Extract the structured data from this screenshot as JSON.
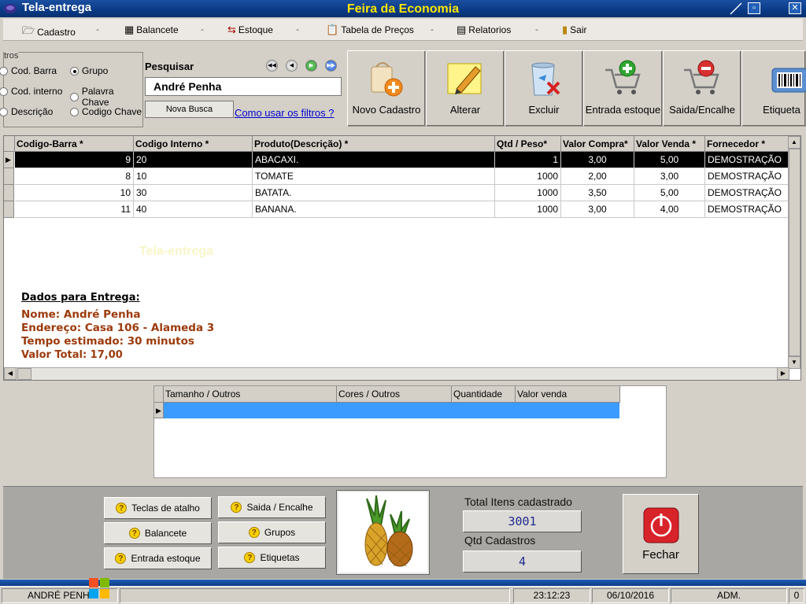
{
  "window": {
    "title": "Tela-entrega",
    "app_name": "Feira da Economia",
    "btn_restore": "▫",
    "btn_close": "✕"
  },
  "menu": {
    "items": [
      {
        "label": "Cadastro",
        "icon": "folder-icon"
      },
      {
        "label": "Balancete",
        "icon": "calculator-icon"
      },
      {
        "label": "Estoque",
        "icon": "stock-icon"
      },
      {
        "label": "Tabela de Preços",
        "icon": "clipboard-icon"
      },
      {
        "label": "Relatorios",
        "icon": "reports-icon"
      },
      {
        "label": "Sair",
        "icon": "exit-icon"
      }
    ],
    "separator": "-"
  },
  "filters": {
    "legend": "tros",
    "options": [
      {
        "label": "Cod. Barra",
        "selected": false
      },
      {
        "label": "Grupo",
        "selected": true
      },
      {
        "label": "Cod. interno",
        "selected": false
      },
      {
        "label": "Palavra Chave",
        "selected": false
      },
      {
        "label": "Descrição",
        "selected": false
      },
      {
        "label": "Codigo Chave",
        "selected": false
      }
    ]
  },
  "search": {
    "label": "Pesquisar",
    "value": "André Penha",
    "new_search": "Nova Busca",
    "help_link": "Como usar os filtros ?"
  },
  "toolbar": {
    "buttons": [
      {
        "label": "Novo Cadastro",
        "icon": "new-record-icon"
      },
      {
        "label": "Alterar",
        "icon": "edit-icon"
      },
      {
        "label": "Excluir",
        "icon": "recycle-bin-icon"
      },
      {
        "label": "Entrada estoque",
        "icon": "cart-add-icon"
      },
      {
        "label": "Saida/Encalhe",
        "icon": "cart-remove-icon"
      },
      {
        "label": "Etiqueta",
        "icon": "barcode-icon"
      }
    ]
  },
  "grid": {
    "columns": [
      "Codigo-Barra  *",
      "Codigo Interno *",
      "Produto(Descrição)    *",
      "Qtd / Peso*",
      "Valor Compra*",
      "Valor Venda *",
      "Fornecedor    *"
    ],
    "rows": [
      [
        "9",
        "20",
        "ABACAXI.",
        "1",
        "3,00",
        "5,00",
        "DEMOSTRAÇÃO"
      ],
      [
        "8",
        "10",
        "TOMATE",
        "1000",
        "2,00",
        "3,00",
        "DEMOSTRAÇÃO"
      ],
      [
        "10",
        "30",
        "BATATA.",
        "1000",
        "3,50",
        "5,00",
        "DEMOSTRAÇÃO"
      ],
      [
        "11",
        "40",
        "BANANA.",
        "1000",
        "3,00",
        "4,00",
        "DEMOSTRAÇÃO"
      ]
    ],
    "selected_row": 0,
    "watermark": "Tela-entrega"
  },
  "delivery": {
    "title": "Dados para Entrega:",
    "name": "Nome: André Penha",
    "address": "Endereço: Casa 106 - Alameda 3",
    "time": "Tempo estimado: 30 minutos",
    "total": "Valor Total: 17,00"
  },
  "subgrid": {
    "columns": [
      "Tamanho / Outros",
      "Cores / Outros",
      "Quantidade",
      "Valor venda"
    ]
  },
  "bottom": {
    "shortcuts": [
      {
        "label": "Teclas de atalho"
      },
      {
        "label": "Saida / Encalhe"
      },
      {
        "label": "Balancete"
      },
      {
        "label": "Grupos"
      },
      {
        "label": "Entrada estoque"
      },
      {
        "label": "Etiquetas"
      }
    ],
    "total_items_label": "Total Itens cadastrado",
    "total_items_value": "3001",
    "qtd_label": "Qtd Cadastros",
    "qtd_value": "4",
    "close_label": "Fechar"
  },
  "status": {
    "user": "ANDRÉ PENHA",
    "time": "23:12:23",
    "date": "06/10/2016",
    "role": "ADM.",
    "count": "0"
  },
  "colors": {
    "titlebar": "#0a3a86",
    "app_name": "#ffe600",
    "selected_row": "#000000",
    "subgrid_selection": "#3b9bff",
    "delivery_text": "#9c3a0b",
    "link": "#0000cc"
  }
}
